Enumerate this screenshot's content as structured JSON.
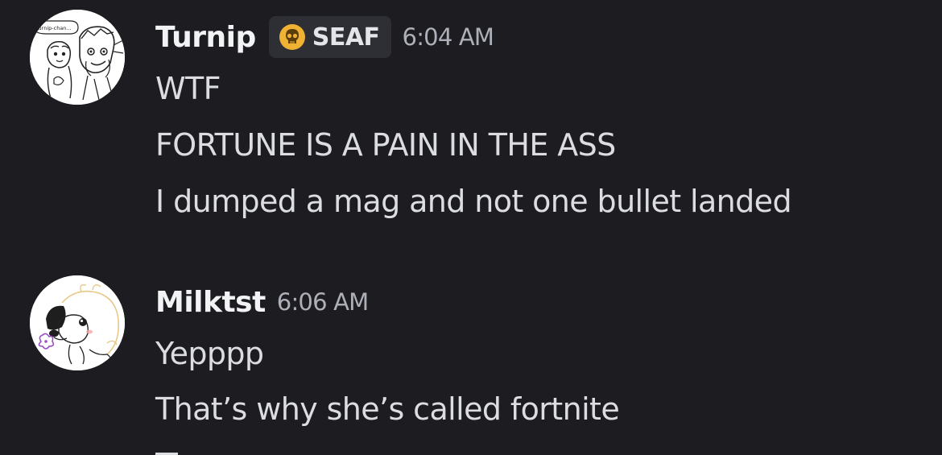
{
  "messages": [
    {
      "username": "Turnip",
      "tag": {
        "icon": "skull-icon",
        "label": "SEAF",
        "icon_color": "#f0b232"
      },
      "timestamp": "6:04 AM",
      "avatar": {
        "caption": "turnip-chan..."
      },
      "lines": [
        "WTF",
        "FORTUNE IS A PAIN IN THE ASS",
        "I dumped a mag and not one bullet landed"
      ]
    },
    {
      "username": "Milktst",
      "timestamp": "6:06 AM",
      "lines": [
        "Yepppp",
        "That’s why she’s called fortnite"
      ]
    }
  ],
  "colors": {
    "background": "#1c1c21",
    "username": "#f2f3f5",
    "message_text": "#dbdde1",
    "timestamp": "#aeb0b8",
    "tag_background": "#2e2f35"
  }
}
